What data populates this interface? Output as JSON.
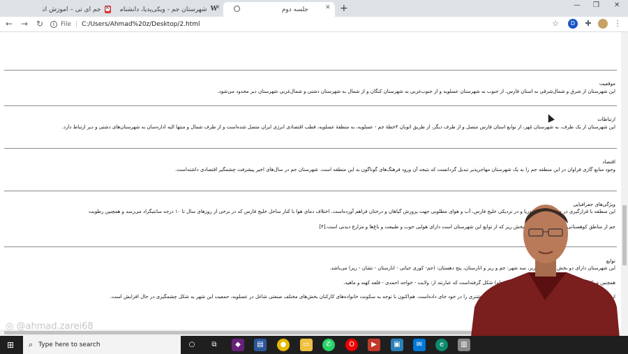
{
  "browser": {
    "tabs": [
      {
        "title": "جم آی تی – آموزش آنلاین",
        "favicon": "site-icon",
        "active": false
      },
      {
        "title": "شهرستان جم - ویکی‌پدیا، دانشنامهٔ",
        "favicon": "W",
        "active": false
      },
      {
        "title": "جلسه دوم",
        "favicon": "globe-icon",
        "active": true
      }
    ],
    "new_tab": "+",
    "url_prefix": "File",
    "url": "C:/Users/Ahmad%20z/Desktop/2.html"
  },
  "sections": [
    {
      "heading": "موقعیت",
      "lines": [
        "این شهرستان از شرق و شمال‌شرقی به استان فارس، از جنوب به شهرستان عسلویه و از جنوب‌غربی به شهرستان کنگان و از شمال به شهرستان دشتی و شمال‌غربی شهرستان دیر محدود می‌شود."
      ]
    },
    {
      "heading": "ارتباطات",
      "lines": [
        "این شهرستان از یک طرف، به شهرستان مُهر، از توابع استان فارس متصل و از طرف دیگر، از طریق اتوبان ۴خطهٔ جم - عسلویه، به منطقهٔ عسلویه، قطب اقتصادی انرژی ایران متصل شده‌است و از طرف شمال و منتها الیه اداره‌سان به شهرستان‌های دشتی و دیر ارتباط دارد."
      ]
    },
    {
      "heading": "اقتصاد",
      "lines": [
        "وجود منابع گازی فراوان در این منطقه جم را به یک شهرستان مهاجرپذیر تبدیل گردانست که نتیجه آن ورود فرهنگ‌های گوناگون به این منطقه است. شهرستان جم در سال‌های اخیر پیشرفت چشمگیر اقتصادی داشته‌است."
      ]
    },
    {
      "heading": "ویژگی‌های جغرافیایی",
      "lines": [
        "این منطقه با قرارگیری در متری از سطح دریا و در نزدیکی خلیج فارس، آب و هوای مطلوبی جهت پرورش گیاهان و درختان فراهم آورده‌است. اختلاف دمای هوا با کنار ساحل خلیج فارس که در برخی از روزهای سال تا ۱۰ درجه سانتیگراد می‌رسد و همچنین رطوبت",
        "جم از مناطق کوهستانی استان بوشهر است. بخش ریز که از توابع این شهرستان است دارای هوایی خوب و طبیعت و باغ‌ها و مزارع دیدنی است.[۴]"
      ]
    },
    {
      "heading": "توابع",
      "lines": [
        "این شهرستان دارای دو بخش مرکزی و ریز، سه شهر: جم و ریز و انارستان، پنج دهستان: (جم- کوری حیاتی - انارستان - تشان - ریز) می‌باشد.",
        "همچنین مرکز این شهرستان در چندین روستای بزرگ (محله) شکل گرفته‌است که عبارتند از: ولایت - خواجه احمدی - قلعه کهنه و ماهیه.",
        "از نظر وسعت و لحاظ جمعیت و تراکم جمعیتی بخش جم جمعیت بیشتری را در خود جای داده‌است. هم‌اکنون با توجه به سکونت خانواده‌های کارکنان بخش‌های مختلف صنعتی شاغل در عسلویه، جمعیت این شهر به شکل چشمگیری در حال افزایش است."
      ]
    }
  ],
  "watermark": "@ahmad.zarei68",
  "taskbar": {
    "search_placeholder": "Type here to search"
  }
}
